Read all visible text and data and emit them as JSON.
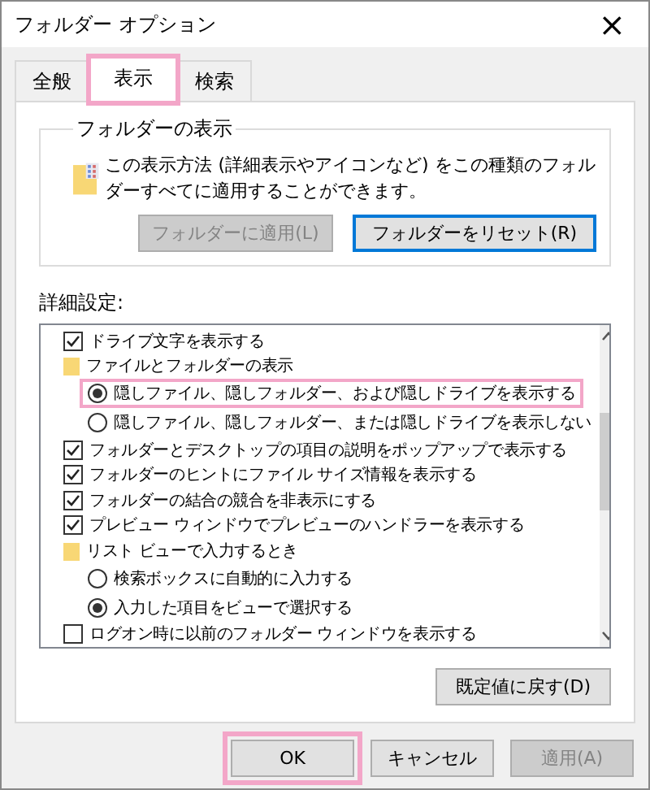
{
  "window": {
    "title": "フォルダー オプション",
    "close": "×"
  },
  "tabs": [
    {
      "label": "全般",
      "selected": false,
      "highlighted": false
    },
    {
      "label": "表示",
      "selected": true,
      "highlighted": true
    },
    {
      "label": "検索",
      "selected": false,
      "highlighted": false
    }
  ],
  "folder_view": {
    "title": "フォルダーの表示",
    "description": "この表示方法 (詳細表示やアイコンなど) をこの種類のフォルダーすべてに適用することができます。",
    "buttons": [
      {
        "label": "フォルダーに適用(L)",
        "disabled": true
      },
      {
        "label": "フォルダーをリセット(R)",
        "disabled": false
      }
    ]
  },
  "advanced": {
    "label": "詳細設定:",
    "items": [
      {
        "kind": "checkbox",
        "label": "ドライブ文字を表示する",
        "checked": true
      },
      {
        "kind": "folder",
        "label": "ファイルとフォルダーの表示",
        "children": [
          {
            "kind": "radio",
            "label": "隠しファイル、隠しフォルダー、および隠しドライブを表示する",
            "checked": true,
            "highlighted": true
          },
          {
            "kind": "radio",
            "label": "隠しファイル、隠しフォルダー、または隠しドライブを表示しない",
            "checked": false,
            "highlighted": false
          }
        ]
      },
      {
        "kind": "checkbox",
        "label": "フォルダーとデスクトップの項目の説明をポップアップで表示する",
        "checked": true
      },
      {
        "kind": "checkbox",
        "label": "フォルダーのヒントにファイル サイズ情報を表示する",
        "checked": true
      },
      {
        "kind": "checkbox",
        "label": "フォルダーの結合の競合を非表示にする",
        "checked": true
      },
      {
        "kind": "checkbox",
        "label": "プレビュー ウィンドウでプレビューのハンドラーを表示する",
        "checked": true
      },
      {
        "kind": "folder",
        "label": "リスト ビューで入力するとき",
        "children": [
          {
            "kind": "radio",
            "label": "検索ボックスに自動的に入力する",
            "checked": false,
            "highlighted": false
          },
          {
            "kind": "radio",
            "label": "入力した項目をビューで選択する",
            "checked": true,
            "highlighted": false
          }
        ]
      },
      {
        "kind": "checkbox",
        "label": "ログオン時に以前のフォルダー ウィンドウを表示する",
        "checked": false
      }
    ],
    "restore_button": "既定値に戻す(D)"
  },
  "buttons": [
    {
      "label": "OK",
      "disabled": false,
      "highlighted": true
    },
    {
      "label": "キャンセル",
      "disabled": false,
      "highlighted": false
    },
    {
      "label": "適用(A)",
      "disabled": true,
      "highlighted": false
    }
  ]
}
